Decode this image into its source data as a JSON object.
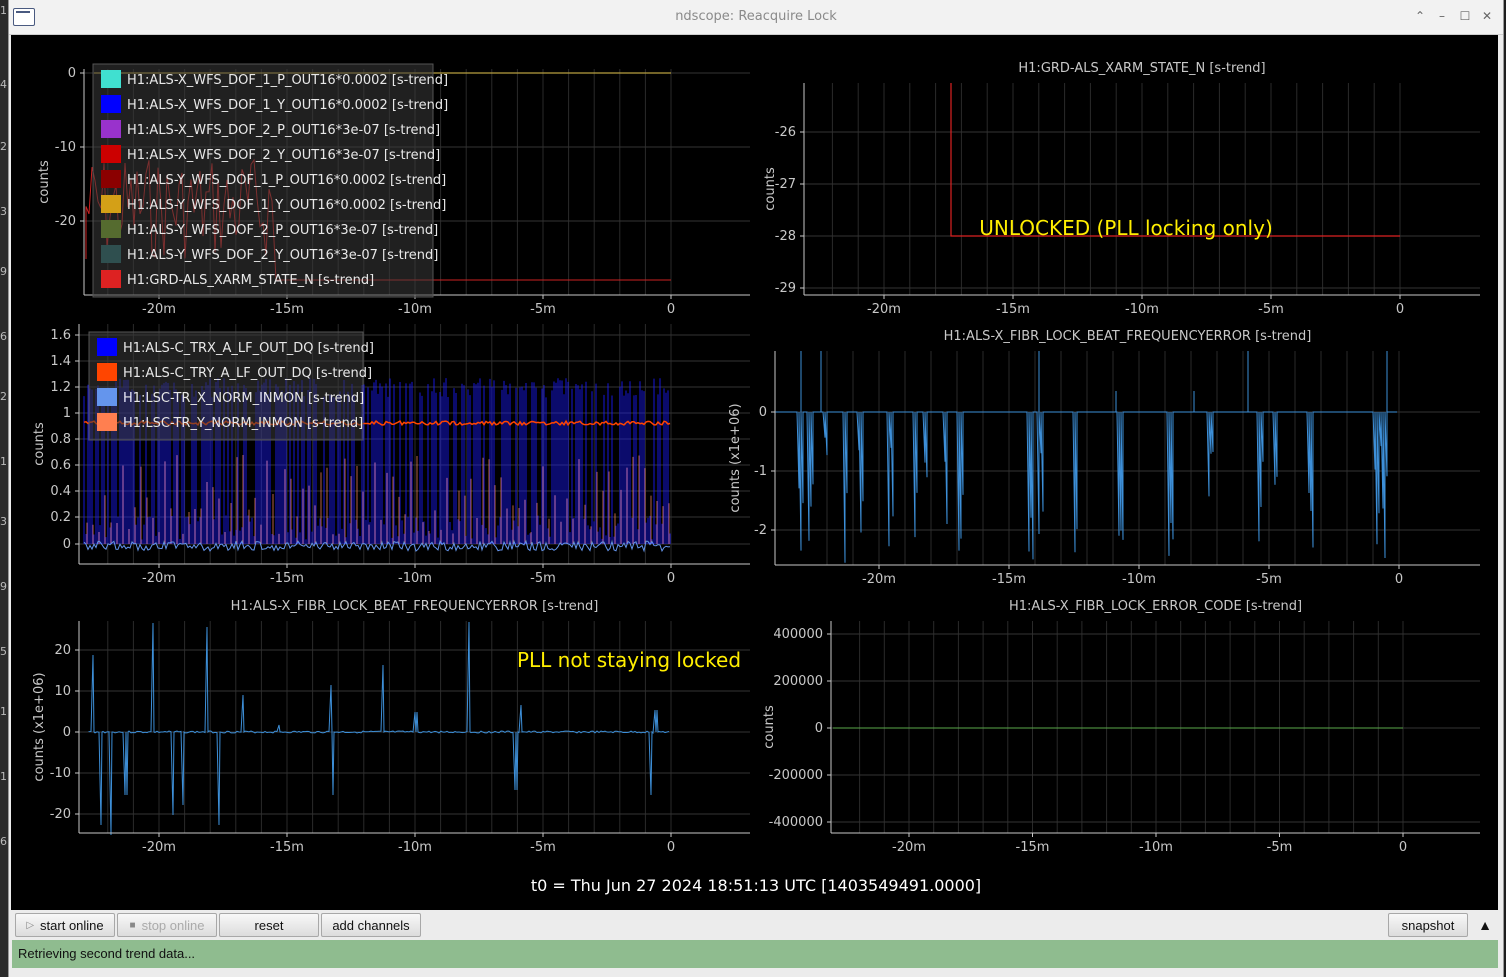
{
  "window": {
    "title": "ndscope: Reacquire Lock",
    "minimize_icon": "chevron-up-icon",
    "restore_icon": "minimize-icon"
  },
  "colors": {
    "bg": "#000000",
    "axis": "#c8c8c8",
    "grid": "#333333",
    "annotation": "#ffee00",
    "status_bg": "#8fbc8f"
  },
  "plots": {
    "p1": {
      "title": "",
      "ylabel": "counts",
      "yticks": [
        "0",
        "-10",
        "-20"
      ],
      "legend": [
        {
          "label": "H1:ALS-X_WFS_DOF_1_P_OUT16*0.0002 [s-trend]",
          "color": "#40e0d0"
        },
        {
          "label": "H1:ALS-X_WFS_DOF_1_Y_OUT16*0.0002 [s-trend]",
          "color": "#0000ff"
        },
        {
          "label": "H1:ALS-X_WFS_DOF_2_P_OUT16*3e-07 [s-trend]",
          "color": "#9932cc"
        },
        {
          "label": "H1:ALS-X_WFS_DOF_2_Y_OUT16*3e-07 [s-trend]",
          "color": "#cc0000"
        },
        {
          "label": "H1:ALS-Y_WFS_DOF_1_P_OUT16*0.0002 [s-trend]",
          "color": "#8b0000"
        },
        {
          "label": "H1:ALS-Y_WFS_DOF_1_Y_OUT16*0.0002 [s-trend]",
          "color": "#d4a017"
        },
        {
          "label": "H1:ALS-Y_WFS_DOF_2_P_OUT16*3e-07 [s-trend]",
          "color": "#556b2f"
        },
        {
          "label": "H1:ALS-Y_WFS_DOF_2_Y_OUT16*3e-07 [s-trend]",
          "color": "#2f4f4f"
        },
        {
          "label": "H1:GRD-ALS_XARM_STATE_N [s-trend]",
          "color": "#dd2222"
        }
      ]
    },
    "p2": {
      "title": "H1:GRD-ALS_XARM_STATE_N [s-trend]",
      "ylabel": "counts",
      "yticks": [
        "-26",
        "-27",
        "-28",
        "-29"
      ],
      "annotation": "UNLOCKED (PLL locking only)"
    },
    "p3": {
      "title": "",
      "ylabel": "counts",
      "yticks": [
        "1.6",
        "1.4",
        "1.2",
        "1",
        "0.8",
        "0.6",
        "0.4",
        "0.2",
        "0"
      ],
      "legend": [
        {
          "label": "H1:ALS-C_TRX_A_LF_OUT_DQ [s-trend]",
          "color": "#0000ff"
        },
        {
          "label": "H1:ALS-C_TRY_A_LF_OUT_DQ [s-trend]",
          "color": "#ff4500"
        },
        {
          "label": "H1:LSC-TR_X_NORM_INMON [s-trend]",
          "color": "#6495ed"
        },
        {
          "label": "H1:LSC-TR_Y_NORM_INMON [s-trend]",
          "color": "#ff7f50"
        }
      ]
    },
    "p4": {
      "title": "H1:ALS-X_FIBR_LOCK_BEAT_FREQUENCYERROR [s-trend]",
      "ylabel": "counts (x1e+06)",
      "yticks": [
        "0",
        "-1",
        "-2"
      ]
    },
    "p5": {
      "title": "H1:ALS-X_FIBR_LOCK_BEAT_FREQUENCYERROR [s-trend]",
      "ylabel": "counts (x1e+06)",
      "yticks": [
        "20",
        "10",
        "0",
        "-10",
        "-20"
      ],
      "annotation": "PLL not staying locked"
    },
    "p6": {
      "title": "H1:ALS-X_FIBR_LOCK_ERROR_CODE [s-trend]",
      "ylabel": "counts",
      "yticks": [
        "400000",
        "200000",
        "0",
        "-200000",
        "-400000"
      ]
    }
  },
  "xticks": [
    "-20m",
    "-15m",
    "-10m",
    "-5m",
    "0"
  ],
  "t0_label": "t0 = Thu Jun 27 2024 18:51:13 UTC [1403549491.0000]",
  "toolbar": {
    "start_online": "start online",
    "stop_online": "stop online",
    "reset": "reset",
    "add_channels": "add channels",
    "snapshot": "snapshot"
  },
  "status": "Retrieving second trend data..."
}
